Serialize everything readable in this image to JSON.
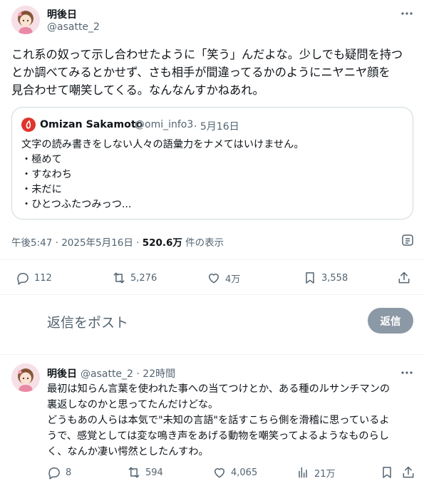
{
  "colors": {
    "text": "#0f1419",
    "secondary": "#536471",
    "border": "#cfd9de",
    "reply_button_bg": "#8b98a5",
    "quote_avatar": "#e0342c"
  },
  "main_tweet": {
    "author_name": "明後日",
    "author_handle": "@asatte_2",
    "more_icon": "more-icon",
    "text_lines": [
      "これ系の奴って示し合わせたように「笑う」んだよな。少しでも疑問を持つ",
      "とか調べてみるとかせず、さも相手が間違ってるかのようにニヤニヤ顔を",
      "見合わせて嘲笑してくる。なんなんすかねあれ。"
    ],
    "quote": {
      "author_name": "Omizan Sakamoto",
      "author_handle": "@omi_info3",
      "date": "· 5月16日",
      "lines": [
        "文字の読み書きをしない人々の語彙力をナメてはいけません。",
        "・極めて",
        "・すなわち",
        "・未だに",
        "・ひとつふたつみっつ..."
      ]
    },
    "timestamp": "午後5:47 · 2025年5月16日 · ",
    "views_count": "520.6万",
    "views_label": " 件の表示",
    "stats": {
      "replies": "112",
      "retweets": "5,276",
      "likes": "4万",
      "bookmarks": "3,558"
    }
  },
  "reply_box": {
    "placeholder": "返信をポスト",
    "button_label": "返信"
  },
  "reply_tweet": {
    "author_name": "明後日",
    "author_handle": "@asatte_2 · 22時間",
    "text_lines": [
      "最初は知らん言葉を使われた事への当てつけとか、ある種のルサンチマンの",
      "裏返しなのかと思ってたんだけどな。",
      "どうもあの人らは本気で\"未知の言語\"を話すこちら側を滑稽に思っているよ",
      "うで、感覚としては変な鳴き声をあげる動物を嘲笑ってよるようなものらし",
      "く、なんか凄い愕然としたんすわ。"
    ],
    "stats": {
      "replies": "8",
      "retweets": "594",
      "likes": "4,065",
      "views": "21万"
    }
  }
}
